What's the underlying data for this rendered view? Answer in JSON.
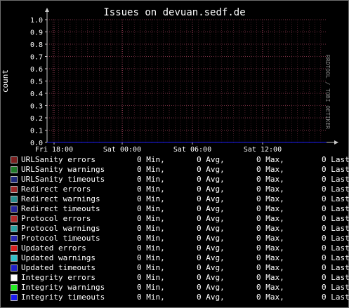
{
  "chart_data": {
    "type": "line",
    "title": "Issues on devuan.sedf.de",
    "ylabel": "count",
    "vendor": "RRDTOOL / TOBI OETIKER",
    "ylim": [
      0,
      1
    ],
    "y_ticks": [
      "0.0",
      "0.1",
      "0.2",
      "0.3",
      "0.4",
      "0.5",
      "0.6",
      "0.7",
      "0.8",
      "0.9",
      "1.0"
    ],
    "x_ticks": [
      "Fri 18:00",
      "Sat 00:00",
      "Sat 06:00",
      "Sat 12:00"
    ],
    "grid": true,
    "colors": {
      "grid": "#a0405a",
      "axis": "#c8c8c8",
      "plot_bg": "#000000"
    },
    "series": [
      {
        "name": "URLSanity errors",
        "color": "#7a1f1f",
        "min": "0 Min,",
        "avg": "0 Avg,",
        "max": "0 Max,",
        "last": "0 Last"
      },
      {
        "name": "URLSanity warnings",
        "color": "#1f7a2a",
        "min": "0 Min,",
        "avg": "0 Avg,",
        "max": "0 Max,",
        "last": "0 Last"
      },
      {
        "name": "URLSanity timeouts",
        "color": "#1f2a7a",
        "min": "0 Min,",
        "avg": "0 Avg,",
        "max": "0 Max,",
        "last": "0 Last"
      },
      {
        "name": "Redirect errors",
        "color": "#9a2626",
        "min": "0 Min,",
        "avg": "0 Avg,",
        "max": "0 Max,",
        "last": "0 Last"
      },
      {
        "name": "Redirect warnings",
        "color": "#268c8c",
        "min": "0 Min,",
        "avg": "0 Avg,",
        "max": "0 Max,",
        "last": "0 Last"
      },
      {
        "name": "Redirect timeouts",
        "color": "#26269a",
        "min": "0 Min,",
        "avg": "0 Avg,",
        "max": "0 Max,",
        "last": "0 Last"
      },
      {
        "name": "Protocol errors",
        "color": "#b22a2a",
        "min": "0 Min,",
        "avg": "0 Avg,",
        "max": "0 Max,",
        "last": "0 Last"
      },
      {
        "name": "Protocol warnings",
        "color": "#2aa0a0",
        "min": "0 Min,",
        "avg": "0 Avg,",
        "max": "0 Max,",
        "last": "0 Last"
      },
      {
        "name": "Protocol timeouts",
        "color": "#2a2ab2",
        "min": "0 Min,",
        "avg": "0 Avg,",
        "max": "0 Max,",
        "last": "0 Last"
      },
      {
        "name": "Updated errors",
        "color": "#d81e1e",
        "min": "0 Min,",
        "avg": "0 Avg,",
        "max": "0 Max,",
        "last": "0 Last"
      },
      {
        "name": "Updated warnings",
        "color": "#30c0c8",
        "min": "0 Min,",
        "avg": "0 Avg,",
        "max": "0 Max,",
        "last": "0 Last"
      },
      {
        "name": "Updated timeouts",
        "color": "#2020c8",
        "min": "0 Min,",
        "avg": "0 Avg,",
        "max": "0 Max,",
        "last": "0 Last"
      },
      {
        "name": "Integrity errors",
        "color": "#ffffff",
        "min": "0 Min,",
        "avg": "0 Avg,",
        "max": "0 Max,",
        "last": "0 Last"
      },
      {
        "name": "Integrity warnings",
        "color": "#22ee22",
        "min": "0 Min,",
        "avg": "0 Avg,",
        "max": "0 Max,",
        "last": "0 Last"
      },
      {
        "name": "Integrity timeouts",
        "color": "#1c1cf0",
        "min": "0 Min,",
        "avg": "0 Avg,",
        "max": "0 Max,",
        "last": "0 Last"
      }
    ]
  }
}
